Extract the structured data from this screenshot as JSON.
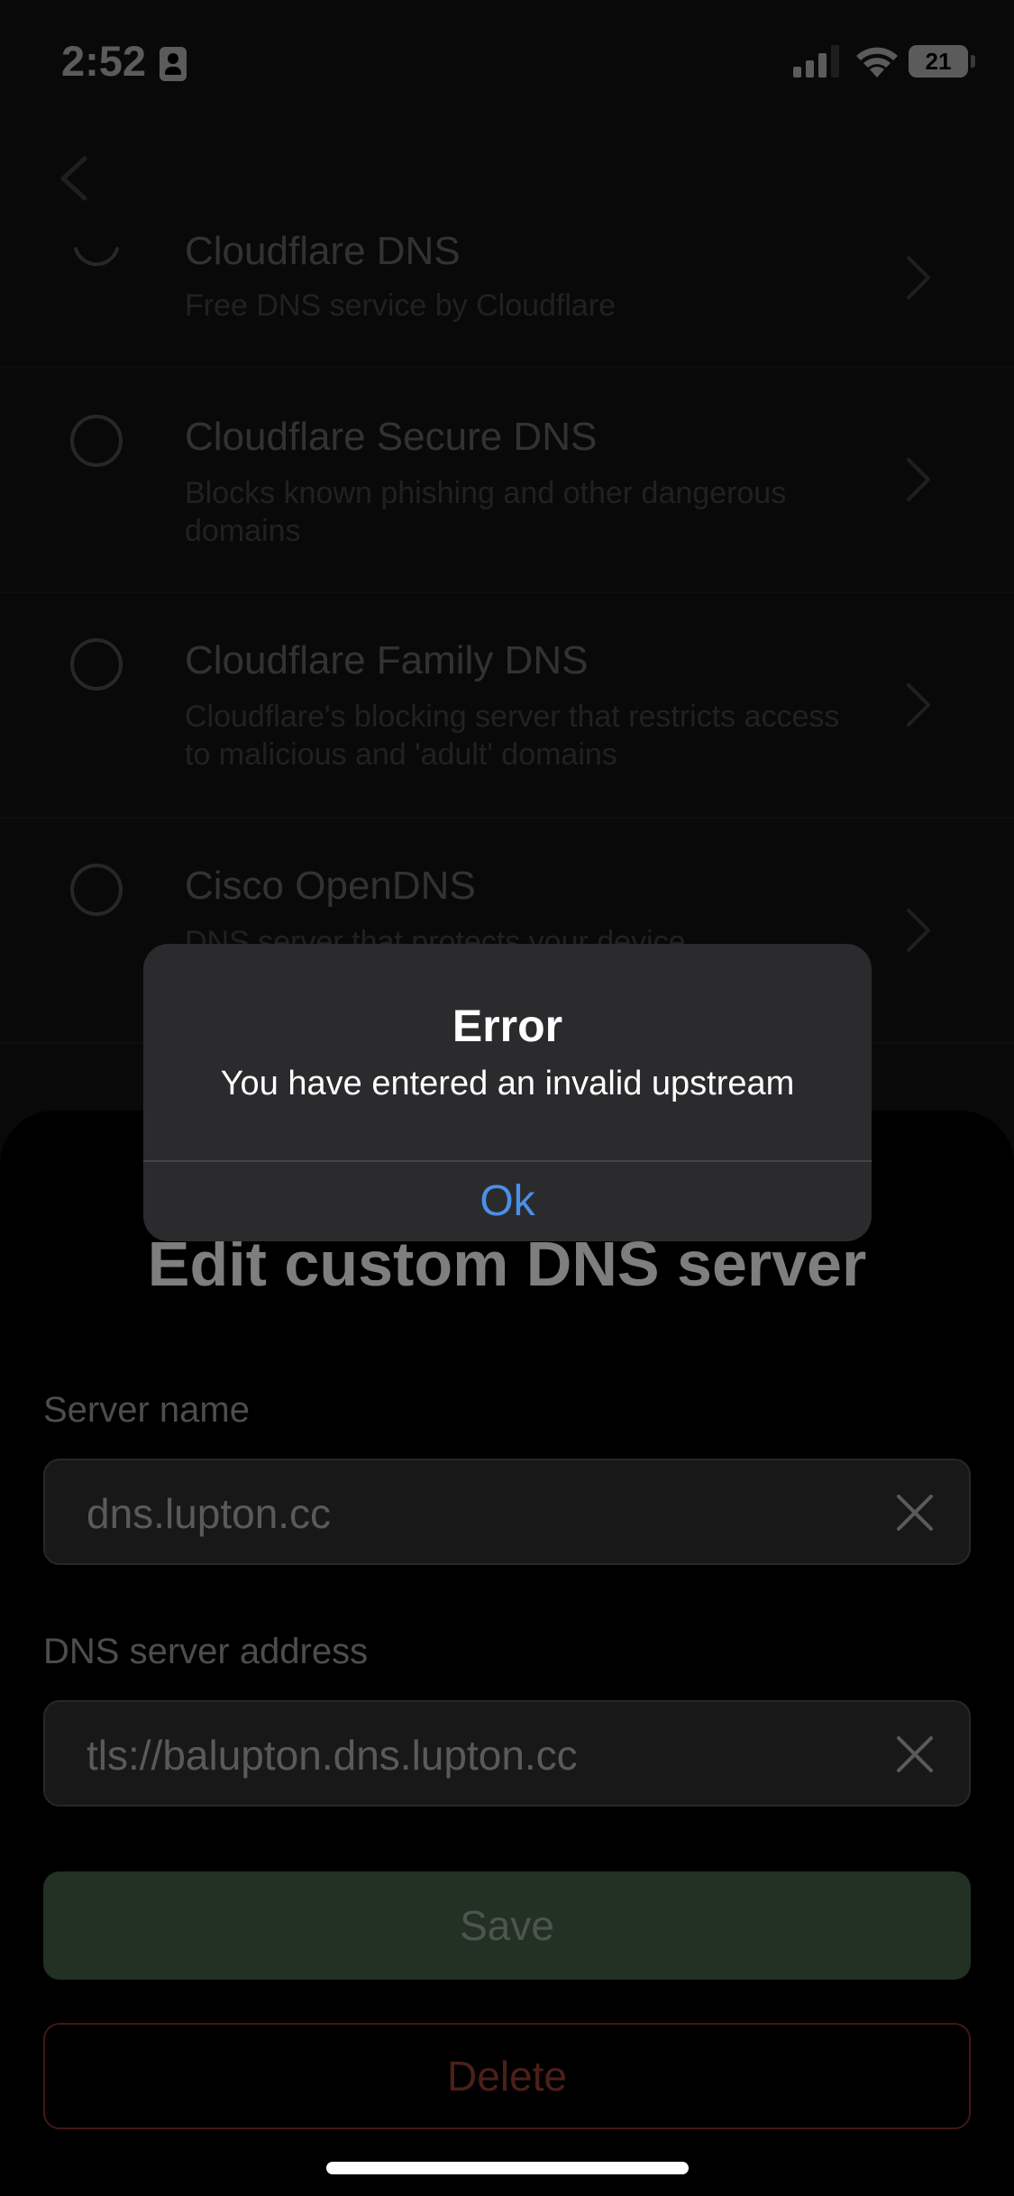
{
  "status_bar": {
    "time": "2:52",
    "battery": "21"
  },
  "dns_list": [
    {
      "title": "Cloudflare DNS",
      "description": "Free DNS service by Cloudflare"
    },
    {
      "title": "Cloudflare Secure DNS",
      "description": "Blocks known phishing and other dangerous domains"
    },
    {
      "title": "Cloudflare Family DNS",
      "description": "Cloudflare's blocking server that restricts access to malicious and 'adult' domains"
    },
    {
      "title": "Cisco OpenDNS",
      "description": "DNS server that protects your device"
    }
  ],
  "sheet": {
    "title": "Edit custom DNS server",
    "server_name_label": "Server name",
    "server_name_value": "dns.lupton.cc",
    "dns_address_label": "DNS server address",
    "dns_address_value": "tls://balupton.dns.lupton.cc",
    "save_label": "Save",
    "delete_label": "Delete"
  },
  "alert": {
    "title": "Error",
    "message": "You have entered an invalid upstream",
    "ok_label": "Ok"
  },
  "colors": {
    "accent_blue": "#4a90ea",
    "save_green": "#3e5a40",
    "delete_red": "#8a3a30"
  }
}
